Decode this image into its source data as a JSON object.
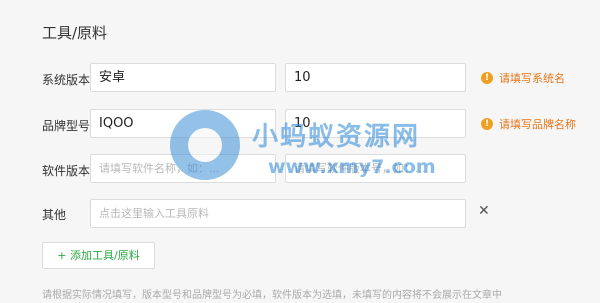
{
  "section_title": "工具/原料",
  "rows": [
    {
      "label": "系统版本",
      "value1": "安卓",
      "value2": "10",
      "hint": "请填写系统名"
    },
    {
      "label": "品牌型号",
      "value1": "IQOO",
      "value2": "10",
      "hint": "请填写品牌名称"
    },
    {
      "label": "软件版本",
      "placeholder1": "请填写软件名称，如：...",
      "placeholder2": "请填写软件版本号，如：..."
    },
    {
      "label": "其他",
      "placeholder": "点击这里输入工具原料"
    }
  ],
  "add_button_label": "+ 添加工具/原料",
  "footnote": "请根据实际情况填写，版本型号和品牌型号为必填，软件版本为选填，未填写的内容将不会展示在文章中",
  "watermark": {
    "text": "小蚂蚁资源网",
    "url": "www.xmy7.com"
  },
  "colors": {
    "hint": "#e8761a",
    "accent_green": "#2aa845",
    "watermark_blue": "#2a86d6"
  },
  "icons": {
    "warning": "warning-icon",
    "close": "close-icon"
  }
}
